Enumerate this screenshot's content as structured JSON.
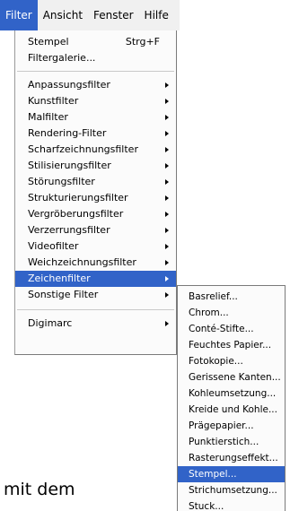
{
  "menubar": {
    "items": [
      {
        "label": "Filter"
      },
      {
        "label": "Ansicht"
      },
      {
        "label": "Fenster"
      },
      {
        "label": "Hilfe"
      }
    ]
  },
  "filter_menu": {
    "stempel": {
      "label": "Stempel",
      "shortcut": "Strg+F"
    },
    "filtergalerie": {
      "label": "Filtergalerie..."
    },
    "items": [
      {
        "label": "Anpassungsfilter"
      },
      {
        "label": "Kunstfilter"
      },
      {
        "label": "Malfilter"
      },
      {
        "label": "Rendering-Filter"
      },
      {
        "label": "Scharfzeichnungsfilter"
      },
      {
        "label": "Stilisierungsfilter"
      },
      {
        "label": "Störungsfilter"
      },
      {
        "label": "Strukturierungsfilter"
      },
      {
        "label": "Vergröberungsfilter"
      },
      {
        "label": "Verzerrungsfilter"
      },
      {
        "label": "Videofilter"
      },
      {
        "label": "Weichzeichnungsfilter"
      },
      {
        "label": "Zeichenfilter"
      },
      {
        "label": "Sonstige Filter"
      }
    ],
    "digimarc": {
      "label": "Digimarc"
    }
  },
  "zeichenfilter_submenu": {
    "items": [
      {
        "label": "Basrelief..."
      },
      {
        "label": "Chrom..."
      },
      {
        "label": "Conté-Stifte..."
      },
      {
        "label": "Feuchtes Papier..."
      },
      {
        "label": "Fotokopie..."
      },
      {
        "label": "Gerissene Kanten..."
      },
      {
        "label": "Kohleumsetzung..."
      },
      {
        "label": "Kreide und Kohle..."
      },
      {
        "label": "Prägepapier..."
      },
      {
        "label": "Punktierstich..."
      },
      {
        "label": "Rasterungseffekt..."
      },
      {
        "label": "Stempel..."
      },
      {
        "label": "Strichumsetzung..."
      },
      {
        "label": "Stuck..."
      }
    ]
  },
  "document": {
    "text": "mit dem"
  }
}
